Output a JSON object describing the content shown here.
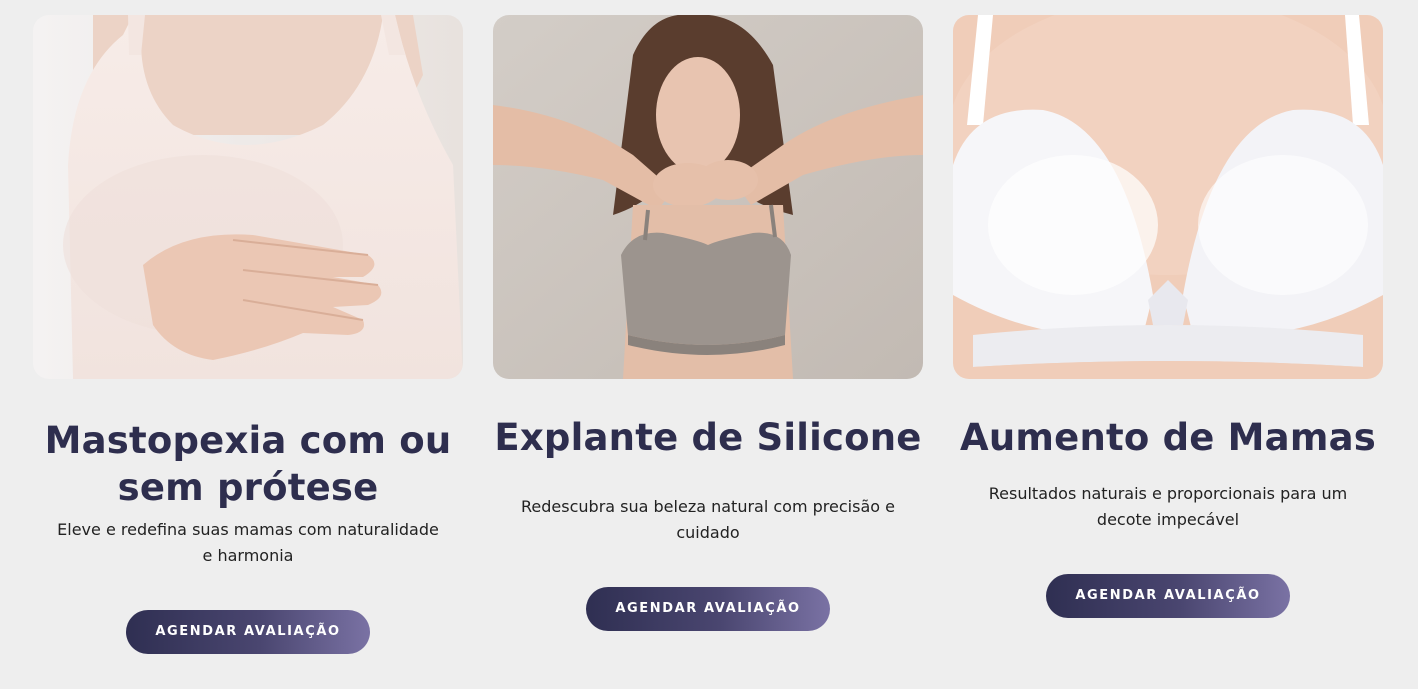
{
  "cards": [
    {
      "title": "Mastopexia com ou sem prótese",
      "description": "Eleve e redefina suas mamas com naturalidade e harmonia",
      "button_label": "AGENDAR AVALIAÇÃO",
      "image_subject": "mastopexia-photo"
    },
    {
      "title": "Explante de Silicone",
      "description": "Redescubra sua beleza natural com precisão e cuidado",
      "button_label": "AGENDAR AVALIAÇÃO",
      "image_subject": "explante-photo"
    },
    {
      "title": "Aumento de Mamas",
      "description": "Resultados naturais e proporcionais para um decote impecável",
      "button_label": "AGENDAR AVALIAÇÃO",
      "image_subject": "aumento-photo"
    }
  ],
  "colors": {
    "background": "#eeeeee",
    "title": "#2e2e4e",
    "button_start": "#2f2f52",
    "button_end": "#7a72a4",
    "button_text": "#ffffff"
  }
}
